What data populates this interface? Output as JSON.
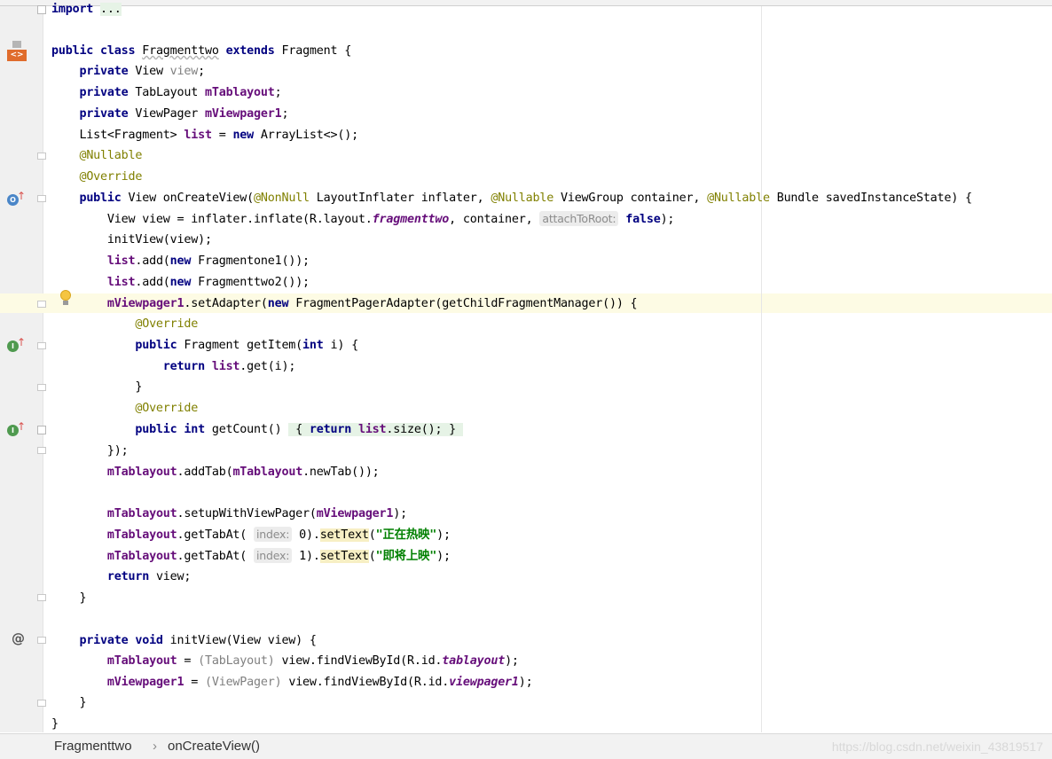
{
  "editor": {
    "import_collapsed": "...",
    "inlay_hints": {
      "attach_to_root": "attachToRoot:",
      "index": "index:"
    },
    "strings": {
      "tab0": "\"正在热映\"",
      "tab1": "\"即将上映\""
    }
  },
  "gutter": {
    "icons": [
      "layout-xml-icon",
      "override-icon",
      "implements-icon",
      "implements-icon",
      "bulb-icon",
      "at-icon"
    ]
  },
  "breadcrumb": {
    "class_name": "Fragmenttwo",
    "separator": "›",
    "method_name": "onCreateView()"
  },
  "watermark": "https://blog.csdn.net/weixin_43819517"
}
